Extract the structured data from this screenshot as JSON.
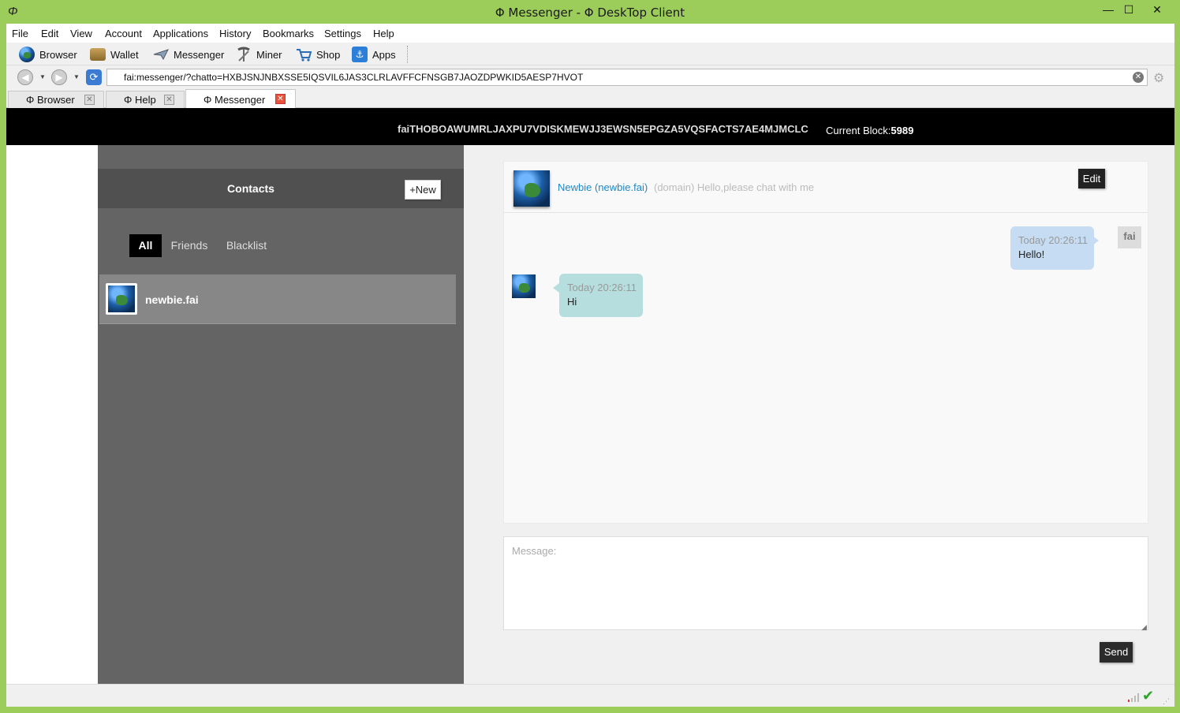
{
  "window": {
    "app_icon": "Φ",
    "title": "Φ Messenger - Φ DeskTop Client",
    "minimize": "—",
    "maximize": "☐",
    "close": "✕"
  },
  "menu": [
    "File",
    "Edit",
    "View",
    "Account",
    "Applications",
    "History",
    "Bookmarks",
    "Settings",
    "Help"
  ],
  "toolbar": [
    {
      "label": "Browser",
      "icon": "globe-icon"
    },
    {
      "label": "Wallet",
      "icon": "wallet-icon"
    },
    {
      "label": "Messenger",
      "icon": "messenger-icon"
    },
    {
      "label": "Miner",
      "icon": "pickaxe-icon"
    },
    {
      "label": "Shop",
      "icon": "cart-icon"
    },
    {
      "label": "Apps",
      "icon": "apps-icon"
    }
  ],
  "address": {
    "url": "fai:messenger/?chatto=HXBJSNJNBXSSE5IQSVIL6JAS3CLRLAVFFCFNSGB7JAOZDPWKID5AESP7HVOT"
  },
  "tabs": [
    {
      "label": "Φ Browser",
      "active": false
    },
    {
      "label": "Φ Help",
      "active": false
    },
    {
      "label": "Φ Messenger",
      "active": true
    }
  ],
  "header": {
    "account_address": "faiTHOBOAWUMRLJAXPU7VDISKMEWJJ3EWSN5EPGZA5VQSFACTS7AE4MJMCLC",
    "block_label": "Current Block:",
    "block_value": "5989"
  },
  "contacts": {
    "title": "Contacts",
    "new_button": "+New",
    "filters": [
      "All",
      "Friends",
      "Blacklist"
    ],
    "selected_filter": "All",
    "items": [
      {
        "name": "newbie.fai"
      }
    ]
  },
  "chat": {
    "peer_name": "Newbie (newbie.fai)",
    "peer_info": "(domain) Hello,please chat with me",
    "edit_button": "Edit",
    "self_tag": "fai",
    "messages": [
      {
        "direction": "out",
        "time": "Today 20:26:11",
        "text": "Hello!"
      },
      {
        "direction": "in",
        "time": "Today 20:26:11",
        "text": "Hi"
      }
    ],
    "message_placeholder": "Message:",
    "send_button": "Send"
  },
  "colors": {
    "window_frame": "#9ccc5a",
    "link": "#1e88c8",
    "outgoing_bubble": "#c6dcf3",
    "incoming_bubble": "#b7dede",
    "status_ok": "#2aa52a"
  }
}
